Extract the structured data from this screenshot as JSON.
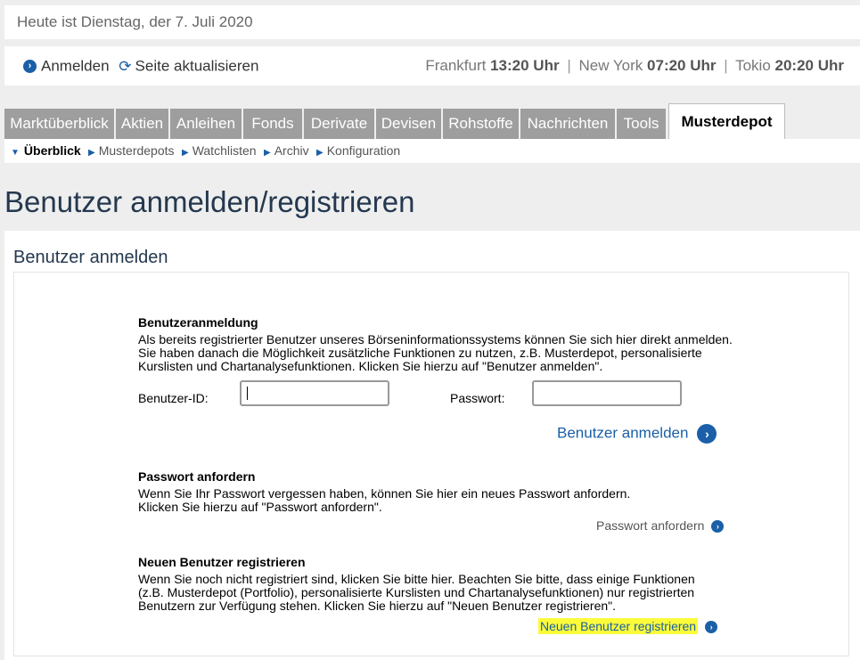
{
  "date_line": "Heute ist Dienstag, der 7. Juli 2020",
  "info_bar": {
    "login_label": "Anmelden",
    "refresh_label": "Seite aktualisieren",
    "clocks": [
      {
        "city": "Frankfurt",
        "time": "13:20 Uhr"
      },
      {
        "city": "New York",
        "time": "07:20 Uhr"
      },
      {
        "city": "Tokio",
        "time": "20:20 Uhr"
      }
    ],
    "separator": "|"
  },
  "tabs": [
    "Marktüberblick",
    "Aktien",
    "Anleihen",
    "Fonds",
    "Derivate",
    "Devisen",
    "Rohstoffe",
    "Nachrichten",
    "Tools",
    "Musterdepot"
  ],
  "subnav": [
    "Überblick",
    "Musterdepots",
    "Watchlisten",
    "Archiv",
    "Konfiguration"
  ],
  "page_title": "Benutzer anmelden/registrieren",
  "panel_title": "Benutzer anmelden",
  "login_section": {
    "heading": "Benutzeranmeldung",
    "text": "Als bereits registrierter Benutzer unseres Börseninformationssystems können Sie sich hier direkt anmelden.\nSie haben danach die Möglichkeit zusätzliche Funktionen zu nutzen, z.B. Musterdepot, personalisierte\nKurslisten und Chartanalysefunktionen. Klicken Sie hierzu auf \"Benutzer anmelden\".",
    "user_id_label": "Benutzer-ID:",
    "user_id_value": "",
    "password_label": "Passwort:",
    "password_value": "",
    "submit_label": "Benutzer anmelden"
  },
  "password_section": {
    "heading": "Passwort anfordern",
    "text": "Wenn Sie Ihr Passwort vergessen haben, können Sie hier ein neues Passwort anfordern.\nKlicken Sie hierzu auf \"Passwort anfordern\".",
    "link_label": "Passwort anfordern"
  },
  "register_section": {
    "heading": "Neuen Benutzer registrieren",
    "text": "Wenn Sie noch nicht registriert sind, klicken Sie bitte hier. Beachten Sie bitte, dass einige Funktionen\n(z.B. Musterdepot (Portfolio), personalisierte Kurslisten und Chartanalysefunktionen) nur registrierten\nBenutzern zur Verfügung stehen. Klicken Sie hierzu auf \"Neuen Benutzer registrieren\".",
    "link_label": "Neuen Benutzer registrieren"
  },
  "colors": {
    "accent": "#1a5fa8",
    "tab_inactive": "#9e9e9e",
    "title": "#24384f",
    "highlight": "#fbfb3a"
  }
}
